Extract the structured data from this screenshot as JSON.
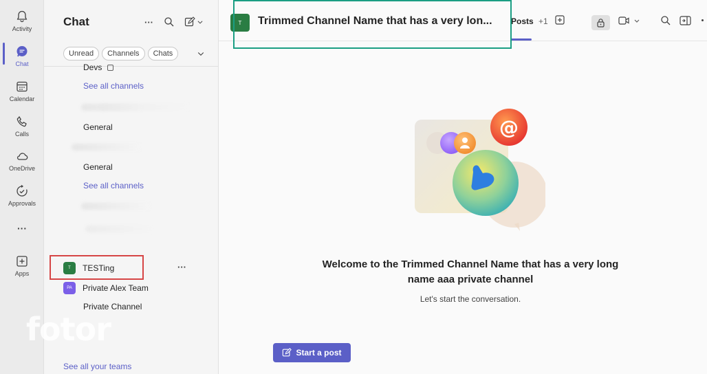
{
  "rail": {
    "items": [
      {
        "label": "Activity",
        "icon": "bell-icon"
      },
      {
        "label": "Chat",
        "icon": "chat-icon"
      },
      {
        "label": "Calendar",
        "icon": "calendar-icon"
      },
      {
        "label": "Calls",
        "icon": "phone-icon"
      },
      {
        "label": "OneDrive",
        "icon": "cloud-icon"
      },
      {
        "label": "Approvals",
        "icon": "approvals-icon"
      },
      {
        "label": "Apps",
        "icon": "add-app-icon"
      }
    ],
    "more_glyph": "···",
    "accent": "#5b5fc7"
  },
  "pane": {
    "title": "Chat",
    "more_glyph": "···",
    "filters": [
      "Unread",
      "Channels",
      "Chats"
    ],
    "tree": {
      "devs": "Devs",
      "see_all_1": "See all channels",
      "general_1": "General",
      "general_2": "General",
      "see_all_2": "See all channels"
    },
    "teams": [
      {
        "name": "TESTing",
        "avatar": "T",
        "color": "#2a7d43"
      },
      {
        "name": "Private Alex Team",
        "avatar": "PA",
        "color": "#7b5fe8"
      },
      {
        "name": "Private Channel",
        "avatar": "",
        "color": ""
      }
    ],
    "row_more_glyph": "···",
    "see_all_teams": "See all your teams",
    "watermark": "fotor"
  },
  "header": {
    "channel_avatar": "T",
    "channel_title": "Trimmed Channel Name that has a very lon...",
    "tab_posts": "Posts",
    "tab_more": "+1"
  },
  "main": {
    "welcome_title": "Welcome to the Trimmed Channel Name that has a very long name aaa private channel",
    "welcome_sub": "Let's start the conversation.",
    "start_post": "Start a post",
    "mention_glyph": "@"
  }
}
